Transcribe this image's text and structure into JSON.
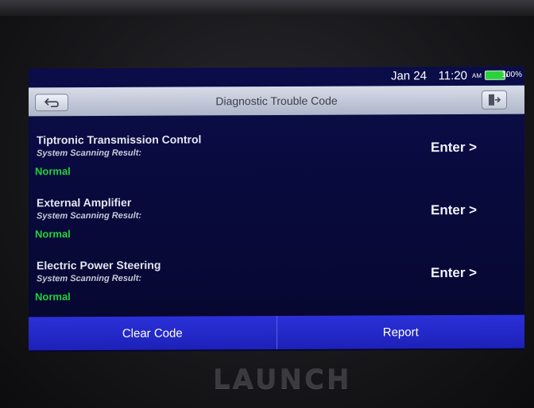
{
  "status_bar": {
    "date": "Jan 24",
    "time": "11:20",
    "ampm": "AM",
    "battery_percent": "100%",
    "battery_level": 1.0
  },
  "header": {
    "title": "Diagnostic Trouble Code",
    "back_icon": "back-arrow-icon",
    "exit_icon": "exit-door-icon"
  },
  "systems": [
    {
      "name": "Tiptronic Transmission Control",
      "caption": "System Scanning Result:",
      "result": "Normal",
      "action": "Enter >"
    },
    {
      "name": "External Amplifier",
      "caption": "System Scanning Result:",
      "result": "Normal",
      "action": "Enter >"
    },
    {
      "name": "Electric Power Steering",
      "caption": "System Scanning Result:",
      "result": "Normal",
      "action": "Enter >"
    }
  ],
  "bottom_bar": {
    "clear_code": "Clear Code",
    "report": "Report"
  },
  "device": {
    "brand": "LAUNCH"
  },
  "colors": {
    "screen_bg": "#080a3c",
    "title_bar": "#c3c9d8",
    "status_normal": "#23d13a",
    "action_button": "#2328c8"
  }
}
